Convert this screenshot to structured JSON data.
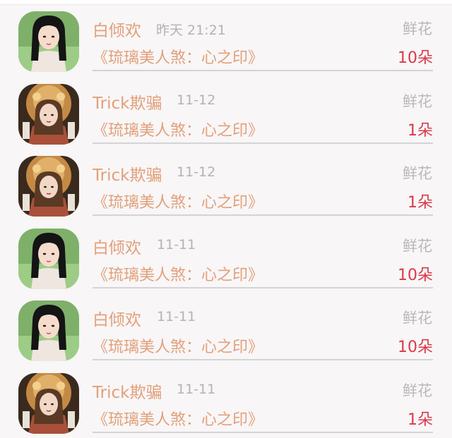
{
  "colors": {
    "name": "#e2a07a",
    "time": "#b3b3b3",
    "gift": "#b9b9b9",
    "count": "#d8394a",
    "divider": "#d4d4d4",
    "background": "#f8f6f7"
  },
  "records": [
    {
      "user": "白倾欢",
      "time": "昨天 21:21",
      "gift": "鲜花",
      "book": "《琉璃美人煞：心之印》",
      "count": "10朵",
      "avatar": "green-hair-girl-avatar"
    },
    {
      "user": "Trick欺骗",
      "time": "11-12",
      "gift": "鲜花",
      "book": "《琉璃美人煞：心之印》",
      "count": "1朵",
      "avatar": "golden-crown-girl-avatar"
    },
    {
      "user": "Trick欺骗",
      "time": "11-12",
      "gift": "鲜花",
      "book": "《琉璃美人煞：心之印》",
      "count": "1朵",
      "avatar": "golden-crown-girl-avatar"
    },
    {
      "user": "白倾欢",
      "time": "11-11",
      "gift": "鲜花",
      "book": "《琉璃美人煞：心之印》",
      "count": "10朵",
      "avatar": "green-hair-girl-avatar"
    },
    {
      "user": "白倾欢",
      "time": "11-11",
      "gift": "鲜花",
      "book": "《琉璃美人煞：心之印》",
      "count": "10朵",
      "avatar": "green-hair-girl-avatar"
    },
    {
      "user": "Trick欺骗",
      "time": "11-11",
      "gift": "鲜花",
      "book": "《琉璃美人煞：心之印》",
      "count": "1朵",
      "avatar": "golden-crown-girl-avatar"
    }
  ]
}
